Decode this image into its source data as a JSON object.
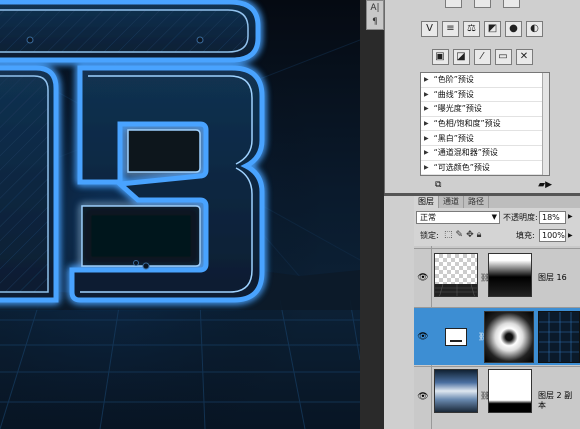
{
  "left_toolbar": {
    "char_label": "A|",
    "para_label": "¶"
  },
  "adjustments_icons": {
    "row1": [
      "levels-icon",
      "curves-icon",
      "exposure-icon",
      "vibrance-icon",
      "hue-saturation-icon",
      "color-balance-icon"
    ],
    "row2": [
      "photo-filter-icon",
      "channel-mixer-icon",
      "invert-icon",
      "posterize-icon",
      "threshold-icon"
    ],
    "row3": [
      "gradient-map-icon",
      "selective-color-icon",
      "bw-icon",
      "mixer-icon",
      "invert2-icon"
    ]
  },
  "presets": [
    "“色阶”预设",
    "“曲线”预设",
    "“曝光度”预设",
    "“色相/饱和度”预设",
    "“黑白”预设",
    "“通道混和器”预设",
    "“可选颜色”预设"
  ],
  "layers_panel": {
    "tabs": [
      "图层",
      "通道",
      "路径"
    ],
    "blend_mode": "正常",
    "opacity_label": "不透明度:",
    "opacity_value": "18%",
    "lock_label": "锁定:",
    "fill_label": "填充:",
    "fill_value": "100%",
    "layers": [
      {
        "name": "图层 16",
        "selected": false
      },
      {
        "name": "",
        "selected": true
      },
      {
        "name": "图层 2 副本",
        "selected": false
      }
    ]
  },
  "colors": {
    "selected_row": "#3d8ed3",
    "neon_blue": "#4aa3ff",
    "canvas_bg": "#06101c"
  }
}
